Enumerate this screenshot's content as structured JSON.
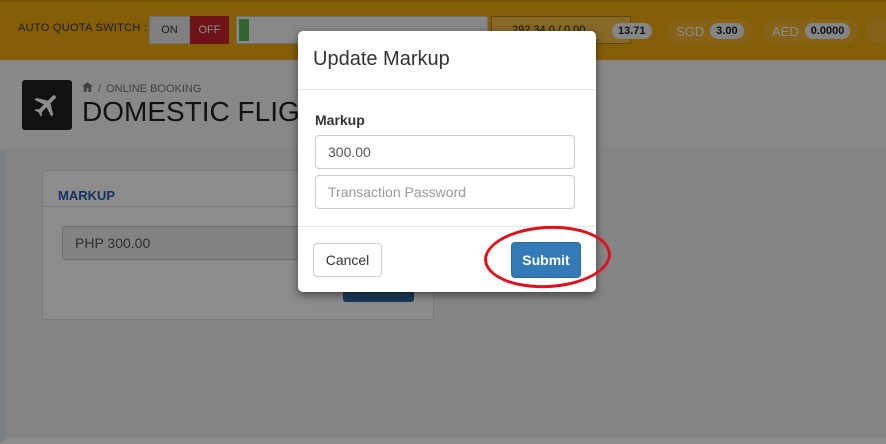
{
  "topbar": {
    "quota_switch_label": "AUTO QUOTA SWITCH :",
    "toggle_on": "ON",
    "toggle_off": "OFF",
    "quota_progress": 0.04,
    "balance_text": "292.34  0 / 0.00",
    "currencies": [
      {
        "code": "",
        "amount": "13.71"
      },
      {
        "code": "SGD",
        "amount": "3.00"
      },
      {
        "code": "AED",
        "amount": "0.0000"
      }
    ]
  },
  "header": {
    "breadcrumb": "ONLINE BOOKING",
    "title": "DOMESTIC FLIGHTS"
  },
  "markup_panel": {
    "heading": "MARKUP",
    "value": "PHP 300.00"
  },
  "modal": {
    "title": "Update Markup",
    "markup_label": "Markup",
    "markup_value": "300.00",
    "password_placeholder": "Transaction Password",
    "cancel_label": "Cancel",
    "submit_label": "Submit"
  },
  "colors": {
    "topbar": "#f0ad10",
    "toggle_off": "#c9252c",
    "primary": "#337ab7",
    "annotation": "#e0101a"
  }
}
